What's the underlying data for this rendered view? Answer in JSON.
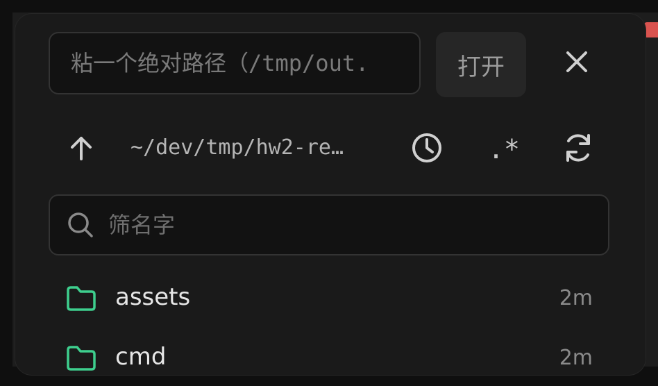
{
  "header": {
    "path_placeholder": "粘一个绝对路径（/tmp/out.",
    "open_label": "打开"
  },
  "toolbar": {
    "cwd": "~/dev/tmp/hw2-re…",
    "regex_label": ".*"
  },
  "filter": {
    "placeholder": "筛名字"
  },
  "entries": [
    {
      "name": "assets",
      "age": "2m"
    },
    {
      "name": "cmd",
      "age": "2m"
    }
  ],
  "colors": {
    "folder": "#3ecf8e",
    "panel": "#1a1a1a",
    "text": "#e6e6e6"
  }
}
